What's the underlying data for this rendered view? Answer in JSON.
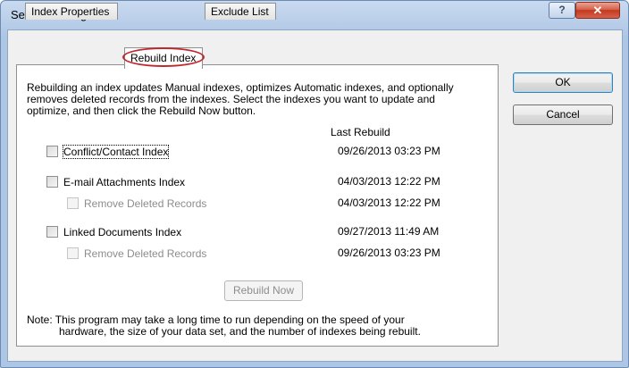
{
  "window": {
    "title": "Search Settings",
    "help_glyph": "?",
    "close_glyph": "✕"
  },
  "tabs": [
    {
      "label": "Index Properties",
      "active": false
    },
    {
      "label": "Rebuild Index",
      "active": true
    },
    {
      "label": "Exclude List",
      "active": false
    }
  ],
  "panel": {
    "description_lines": [
      "Rebuilding an index updates Manual indexes, optimizes Automatic indexes, and optionally",
      "removes deleted records from the indexes.  Select the indexes you want to update and",
      "optimize, and then click the Rebuild Now button."
    ],
    "column_header": "Last Rebuild",
    "rows": [
      {
        "label": "Conflict/Contact Index",
        "date": "09/26/2013  03:23 PM",
        "checked": false,
        "disabled": false
      },
      {
        "label": "E-mail Attachments Index",
        "date": "04/03/2013  12:22 PM",
        "checked": false,
        "disabled": false
      },
      {
        "label": "Remove Deleted Records",
        "date": "04/03/2013  12:22 PM",
        "checked": false,
        "disabled": true
      },
      {
        "label": "Linked Documents Index",
        "date": "09/27/2013  11:49 AM",
        "checked": false,
        "disabled": false
      },
      {
        "label": "Remove Deleted Records",
        "date": "09/26/2013  03:23 PM",
        "checked": false,
        "disabled": true
      }
    ],
    "rebuild_button": "Rebuild Now",
    "note_lines": [
      "Note: This program may take a long time to run depending on the speed of your",
      "hardware, the size of your data set, and the number of indexes being rebuilt."
    ]
  },
  "buttons": {
    "ok": "OK",
    "cancel": "Cancel"
  },
  "colors": {
    "highlight_ring": "#c0272d",
    "close_button": "#c2391d",
    "title_bar": "#b5cbe7"
  }
}
